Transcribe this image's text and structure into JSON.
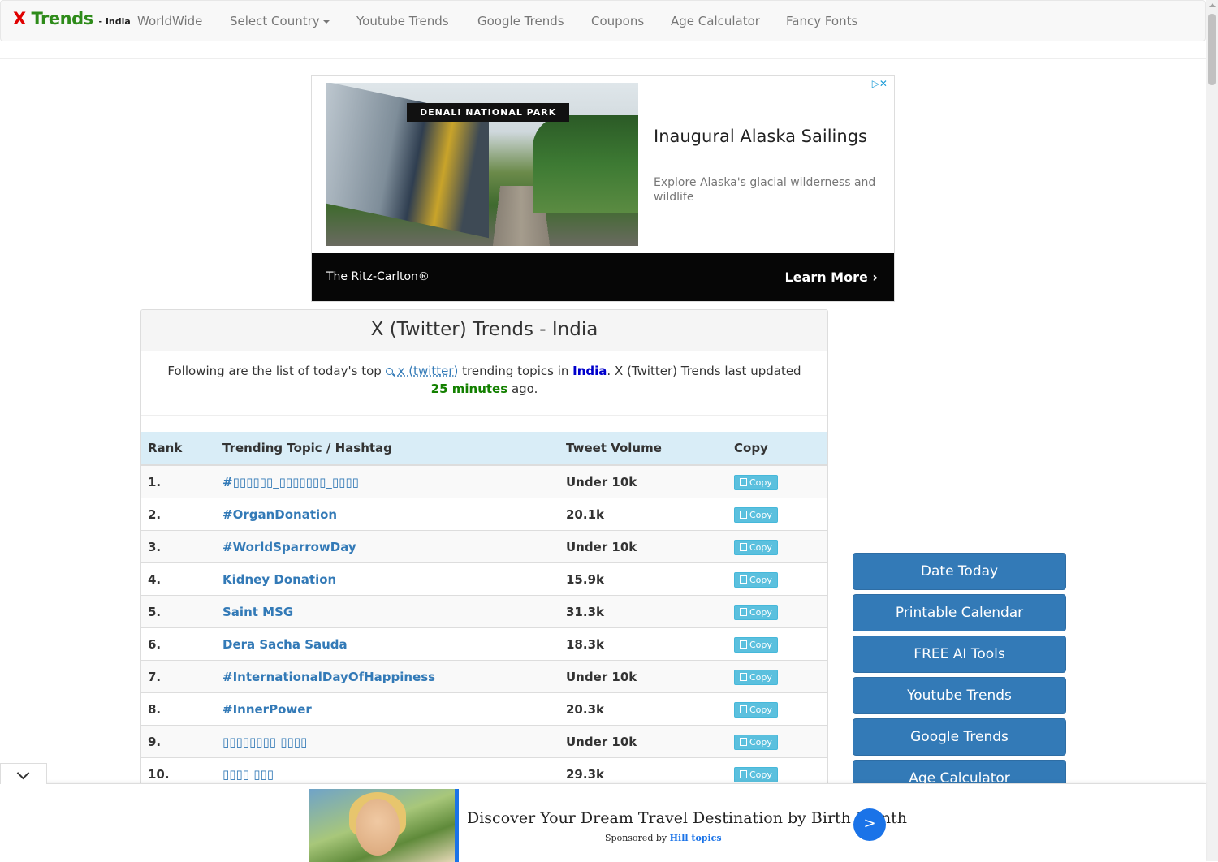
{
  "navbar": {
    "brand": {
      "x": "X",
      "trends": "Trends",
      "country": "- India"
    },
    "items": [
      {
        "label": "WorldWide"
      },
      {
        "label": "Select Country"
      },
      {
        "label": "Youtube Trends"
      },
      {
        "label": "Google Trends"
      },
      {
        "label": "Coupons"
      },
      {
        "label": "Age Calculator"
      },
      {
        "label": "Fancy Fonts"
      }
    ]
  },
  "top_ad": {
    "image_tag": "DENALI NATIONAL PARK",
    "headline": "Inaugural Alaska Sailings",
    "description": "Explore Alaska's glacial wilderness and wildlife",
    "choice": "▷✕",
    "advertiser": "The Ritz-Carlton®",
    "cta": "Learn More ›"
  },
  "panel": {
    "title": "X (Twitter) Trends - India",
    "intro": {
      "p1": "Following are the list of today's top",
      "keyword": "x (twitter)",
      "p2": "trending topics in",
      "country": "India",
      "p3": ". X (Twitter) Trends last updated",
      "minutes": "25 minutes",
      "p4": "ago."
    },
    "columns": [
      "Rank",
      "Trending Topic / Hashtag",
      "Tweet Volume",
      "Copy"
    ],
    "rows": [
      {
        "rank": "1.",
        "topic": "#▯▯▯▯▯▯_▯▯▯▯▯▯▯_▯▯▯▯",
        "volume": "Under 10k",
        "copy": "Copy"
      },
      {
        "rank": "2.",
        "topic": "#OrganDonation",
        "volume": "20.1k",
        "copy": "Copy"
      },
      {
        "rank": "3.",
        "topic": "#WorldSparrowDay",
        "volume": "Under 10k",
        "copy": "Copy"
      },
      {
        "rank": "4.",
        "topic": "Kidney Donation",
        "volume": "15.9k",
        "copy": "Copy"
      },
      {
        "rank": "5.",
        "topic": "Saint MSG",
        "volume": "31.3k",
        "copy": "Copy"
      },
      {
        "rank": "6.",
        "topic": "Dera Sacha Sauda",
        "volume": "18.3k",
        "copy": "Copy"
      },
      {
        "rank": "7.",
        "topic": "#InternationalDayOfHappiness",
        "volume": "Under 10k",
        "copy": "Copy"
      },
      {
        "rank": "8.",
        "topic": "#InnerPower",
        "volume": "20.3k",
        "copy": "Copy"
      },
      {
        "rank": "9.",
        "topic": "▯▯▯▯▯▯▯▯ ▯▯▯▯",
        "volume": "Under 10k",
        "copy": "Copy"
      },
      {
        "rank": "10.",
        "topic": "▯▯▯▯ ▯▯▯",
        "volume": "29.3k",
        "copy": "Copy"
      }
    ]
  },
  "sidebar": {
    "buttons": [
      {
        "label": "Date Today"
      },
      {
        "label": "Printable Calendar"
      },
      {
        "label": "FREE AI Tools"
      },
      {
        "label": "Youtube Trends"
      },
      {
        "label": "Google Trends"
      },
      {
        "label": "Age Calculator"
      }
    ]
  },
  "bottom_ad": {
    "title": "Discover Your Dream Travel Destination by Birth Month",
    "sponsored_by": "Sponsored by",
    "sponsor": "Hill topics",
    "go": ">"
  },
  "colors": {
    "brand_x": "#e00000",
    "brand_trends": "#2e8b1a",
    "link": "#337ab7",
    "sidebar_button": "#337ab7",
    "table_header": "#d9edf7",
    "copy_button": "#5bc0de"
  }
}
